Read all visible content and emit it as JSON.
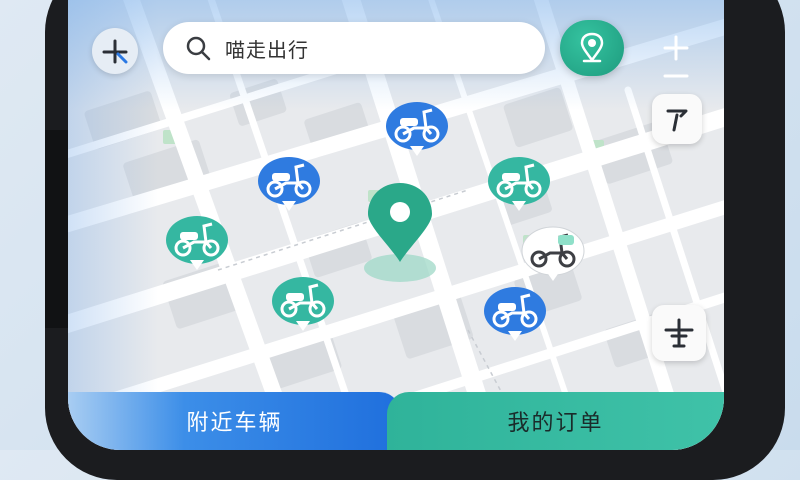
{
  "search": {
    "text": "喵走出行"
  },
  "tabs": [
    {
      "label": "附近车辆",
      "active": true
    },
    {
      "label": "我的订单",
      "active": false
    }
  ],
  "colors": {
    "accent_green": "#2aa889",
    "accent_blue": "#2a78e4",
    "bike_blue": "#2f7be0",
    "bike_teal": "#35b7a1"
  },
  "icons": {
    "top_left": "compass-icon",
    "search": "search-icon",
    "locate": "map-pin-icon",
    "zoom_in": "plus-icon",
    "zoom_out": "minus-icon",
    "flag": "flag-icon",
    "parking": "parking-marker-icon"
  },
  "bike_markers": [
    {
      "name": "bike-marker-1",
      "color": "#2f7be0"
    },
    {
      "name": "bike-marker-2",
      "color": "#2f7be0"
    },
    {
      "name": "bike-marker-3",
      "color": "#35b7a1"
    },
    {
      "name": "bike-marker-4",
      "color": "#35b7a1"
    },
    {
      "name": "bike-marker-5",
      "color": "#35b7a1"
    },
    {
      "name": "bike-marker-6",
      "color": "#ffffff"
    },
    {
      "name": "bike-marker-7",
      "color": "#2f7be0"
    }
  ]
}
